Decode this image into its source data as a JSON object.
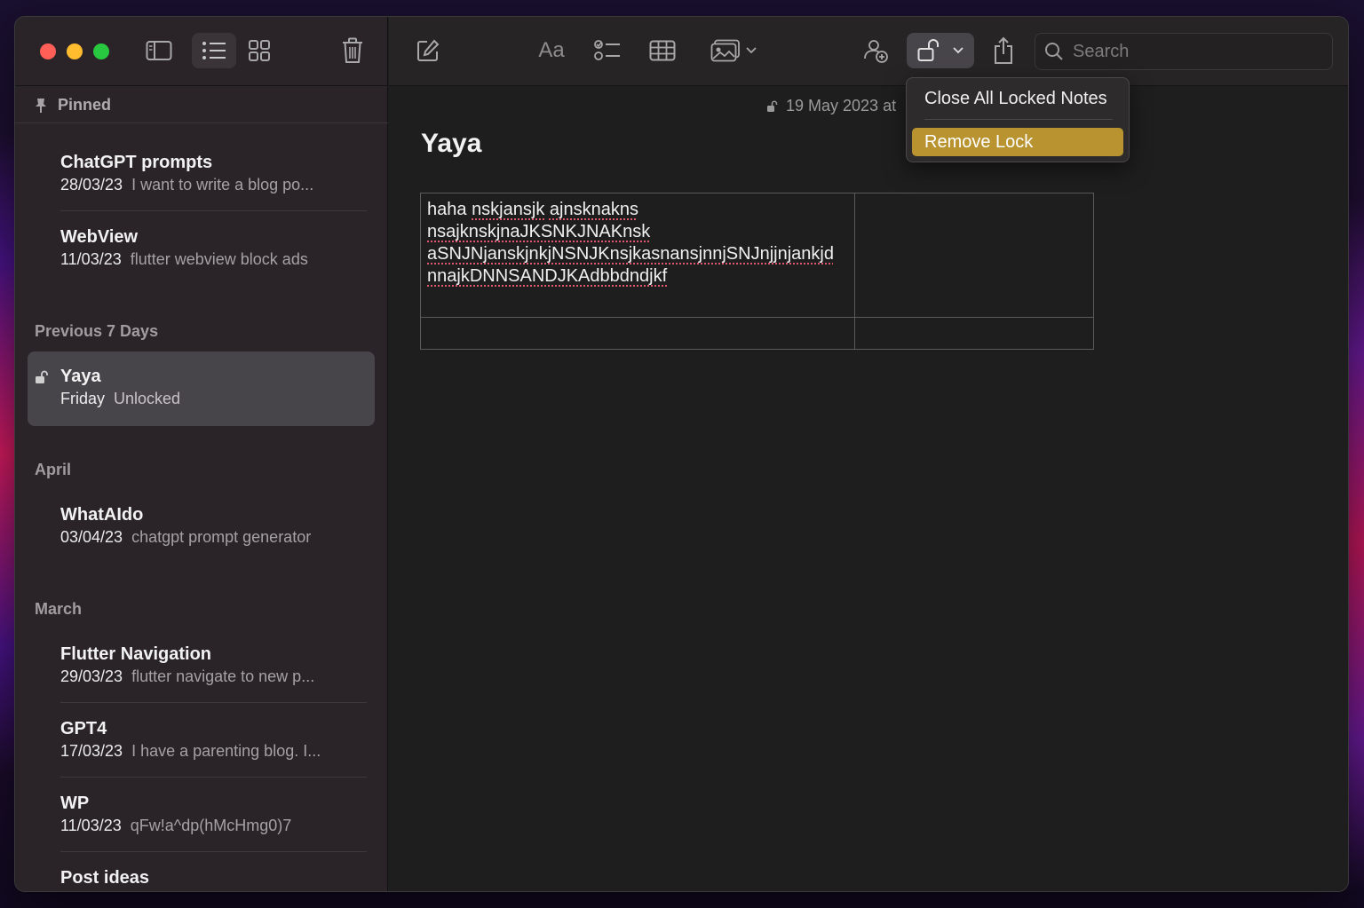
{
  "sidebar": {
    "pinned_label": "Pinned",
    "sections": {
      "previous7": "Previous 7 Days",
      "april": "April",
      "march": "March"
    },
    "notes": [
      {
        "title": "ChatGPT prompts",
        "date": "28/03/23",
        "preview": "I want to write a blog po..."
      },
      {
        "title": "WebView",
        "date": "11/03/23",
        "preview": "flutter webview block ads"
      },
      {
        "title": "Yaya",
        "date": "Friday",
        "preview": "Unlocked"
      },
      {
        "title": "WhatAIdo",
        "date": "03/04/23",
        "preview": "chatgpt prompt generator"
      },
      {
        "title": "Flutter Navigation",
        "date": "29/03/23",
        "preview": "flutter navigate to new p..."
      },
      {
        "title": "GPT4",
        "date": "17/03/23",
        "preview": "I have a parenting blog. I..."
      },
      {
        "title": "WP",
        "date": "11/03/23",
        "preview": "qFw!a^dp(hMcHmg0)7"
      },
      {
        "title": "Post ideas",
        "date": "",
        "preview": ""
      }
    ]
  },
  "toolbar": {
    "format_label": "Aa",
    "search_placeholder": "Search"
  },
  "editor": {
    "date_text": "19 May 2023 at",
    "title": "Yaya",
    "table": {
      "cell_lines": [
        "haha nskjansjk ajnsknakns",
        "nsajknskjnaJKSNKJNAKnsk",
        "aSNJNjanskjnkjNSNJKnsjkasnansjnnjSNJnjjnjankjd",
        "nnajkDNNSANDJKAdbbdndjkf"
      ]
    }
  },
  "lock_menu": {
    "items": [
      "Close All Locked Notes",
      "Remove Lock"
    ]
  },
  "colors": {
    "menu_highlight": "#b8932f",
    "selection": "#48454a",
    "close": "#ff5f57",
    "minimize": "#febc2e",
    "maximize": "#28c840"
  }
}
